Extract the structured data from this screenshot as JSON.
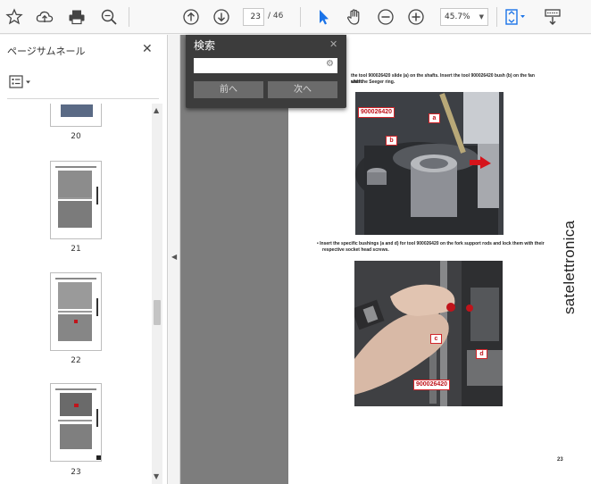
{
  "toolbar": {
    "icons": [
      "bookmark-star-icon",
      "cloud-upload-icon",
      "print-icon",
      "zoom-search-icon",
      "page-up-icon",
      "page-down-icon",
      "select-cursor-icon",
      "hand-tool-icon",
      "zoom-out-icon",
      "zoom-in-icon",
      "fit-page-icon",
      "read-mode-icon"
    ],
    "current_page": "23",
    "page_total": "/ 46",
    "zoom": "45.7%"
  },
  "sidebar": {
    "title": "ページサムネール",
    "close": "✕",
    "thumbnails": [
      {
        "label": "20"
      },
      {
        "label": "21"
      },
      {
        "label": "22"
      },
      {
        "label": "23"
      }
    ]
  },
  "find": {
    "title": "検索",
    "close": "✕",
    "query": "",
    "prev_label": "前へ",
    "next_label": "次へ"
  },
  "document": {
    "line1": "the tool 900026420 slide (a) on the shafts. Insert the tool 900026420 bush (b) on the fan shaft",
    "line2": "with the Seeger ring.",
    "bullet": "Insert the specific bushings (a and d) for tool 900026420 on the fork support rods and lock them with their",
    "bullet2": "respective socket head screws.",
    "photo1_tag_code": "900026420",
    "photo1_tag_a": "a",
    "photo1_tag_b": "b",
    "photo2_tag_c": "c",
    "photo2_tag_d": "d",
    "photo2_tag_code": "900026420",
    "watermark": "satelettronica",
    "page_number": "23"
  },
  "colors": {
    "accent": "#1a73e8",
    "tag_red": "#c0141b",
    "find_bg": "#3c3c3c"
  }
}
